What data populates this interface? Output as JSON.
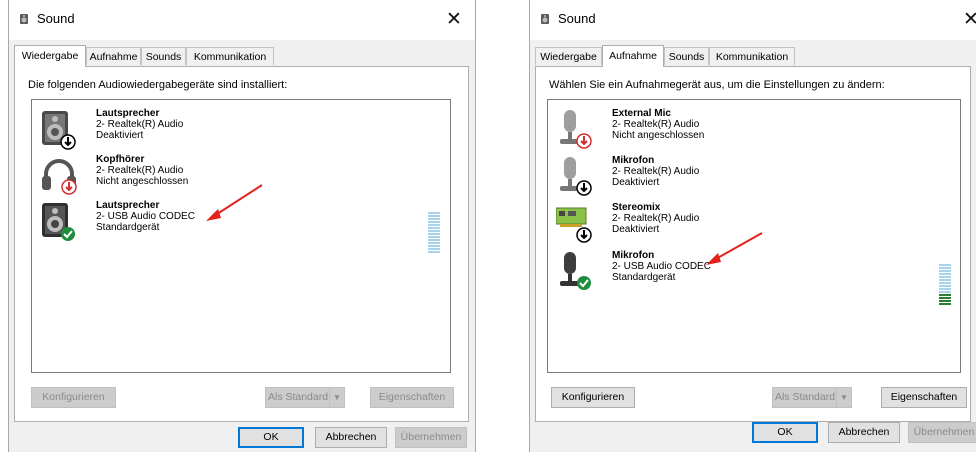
{
  "left_window": {
    "title": "Sound",
    "close_glyph": "✕",
    "tabs": [
      {
        "label": "Wiedergabe",
        "active": true
      },
      {
        "label": "Aufnahme",
        "active": false
      },
      {
        "label": "Sounds",
        "active": false
      },
      {
        "label": "Kommunikation",
        "active": false
      }
    ],
    "heading": "Die folgenden Audiowiedergabegeräte sind installiert:",
    "devices": [
      {
        "name": "Lautsprecher",
        "driver": "2- Realtek(R) Audio",
        "status": "Deaktiviert",
        "icon": "speaker-icon",
        "badge": "down-arrow-badge"
      },
      {
        "name": "Kopfhörer",
        "driver": "2- Realtek(R) Audio",
        "status": "Nicht angeschlossen",
        "icon": "headphones-icon",
        "badge": "red-down-arrow-badge"
      },
      {
        "name": "Lautsprecher",
        "driver": "2- USB Audio CODEC",
        "status": "Standardgerät",
        "icon": "speaker-icon",
        "badge": "green-check-badge"
      }
    ],
    "buttons": {
      "configure": "Konfigurieren",
      "set_default": "Als Standard",
      "properties": "Eigenschaften",
      "ok": "OK",
      "cancel": "Abbrechen",
      "apply": "Übernehmen"
    },
    "level_meter": {
      "level": 0.0
    }
  },
  "right_window": {
    "title": "Sound",
    "close_glyph": "✕",
    "tabs": [
      {
        "label": "Wiedergabe",
        "active": false
      },
      {
        "label": "Aufnahme",
        "active": true
      },
      {
        "label": "Sounds",
        "active": false
      },
      {
        "label": "Kommunikation",
        "active": false
      }
    ],
    "heading": "Wählen Sie ein Aufnahmegerät aus, um die Einstellungen zu ändern:",
    "devices": [
      {
        "name": "External Mic",
        "driver": "2- Realtek(R) Audio",
        "status": "Nicht angeschlossen",
        "icon": "microphone-icon",
        "badge": "red-down-arrow-badge"
      },
      {
        "name": "Mikrofon",
        "driver": "2- Realtek(R) Audio",
        "status": "Deaktiviert",
        "icon": "microphone-icon",
        "badge": "down-arrow-badge"
      },
      {
        "name": "Stereomix",
        "driver": "2- Realtek(R) Audio",
        "status": "Deaktiviert",
        "icon": "sound-card-icon",
        "badge": "down-arrow-badge"
      },
      {
        "name": "Mikrofon",
        "driver": "2- USB Audio CODEC",
        "status": "Standardgerät",
        "icon": "microphone-icon",
        "badge": "green-check-badge"
      }
    ],
    "buttons": {
      "configure": "Konfigurieren",
      "set_default": "Als Standard",
      "properties": "Eigenschaften",
      "ok": "OK",
      "cancel": "Abbrechen",
      "apply": "Übernehmen"
    },
    "level_meter": {
      "level": 0.3
    }
  },
  "colors": {
    "accent": "#0078d7",
    "annotation_arrow": "#e3231b",
    "check_green": "#1e8e3e",
    "down_red": "#d32f2f"
  }
}
